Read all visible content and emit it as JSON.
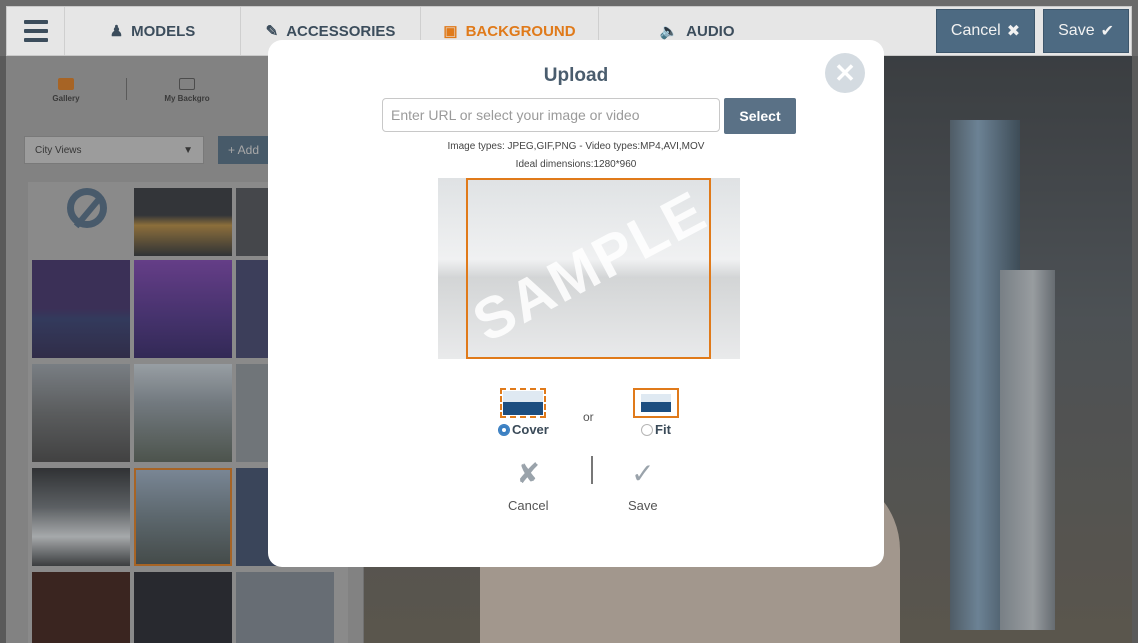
{
  "topbar": {
    "tabs": [
      {
        "label": "MODELS",
        "icon": "person-icon"
      },
      {
        "label": "ACCESSORIES",
        "icon": "wand-icon"
      },
      {
        "label": "BACKGROUND",
        "icon": "image-icon",
        "active": true
      },
      {
        "label": "AUDIO",
        "icon": "speaker-icon"
      }
    ],
    "cancel_label": "Cancel",
    "save_label": "Save"
  },
  "leftpanel": {
    "tabs": [
      {
        "label": "Gallery",
        "icon": "gallery-icon"
      },
      {
        "label": "My Backgro",
        "icon": "folder-icon"
      }
    ],
    "category": "City Views",
    "add_label": "+ Add"
  },
  "modal": {
    "title": "Upload",
    "url_placeholder": "Enter URL or select your image or video",
    "select_label": "Select",
    "types_hint": "Image types: JPEG,GIF,PNG - Video types:MP4,AVI,MOV",
    "dimensions_hint": "Ideal dimensions:1280*960",
    "sample_label": "SAMPLE",
    "or_label": "or",
    "modes": [
      {
        "label": "Cover",
        "selected": true
      },
      {
        "label": "Fit",
        "selected": false
      }
    ],
    "cancel_label": "Cancel",
    "save_label": "Save"
  },
  "colors": {
    "accent": "#e07a1a",
    "primary": "#4d6a82",
    "radio_on": "#3a7fc2"
  }
}
